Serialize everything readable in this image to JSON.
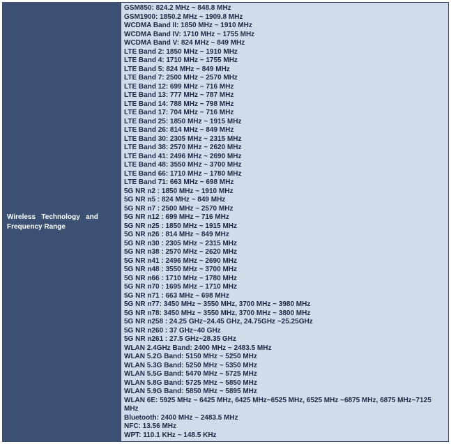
{
  "header": {
    "label_line1": "Wireless",
    "label_line2": "Technology",
    "label_line3": "and",
    "label_line4": "Frequency Range"
  },
  "frequencies": [
    "GSM850: 824.2 MHz ~ 848.8 MHz",
    "GSM1900: 1850.2 MHz ~ 1909.8 MHz",
    "WCDMA Band II: 1850 MHz ~ 1910 MHz",
    "WCDMA Band IV: 1710 MHz ~ 1755 MHz",
    "WCDMA Band V: 824 MHz ~ 849 MHz",
    "LTE Band 2: 1850 MHz ~ 1910 MHz",
    "LTE Band 4: 1710 MHz ~ 1755 MHz",
    "LTE Band 5: 824 MHz ~ 849 MHz",
    "LTE Band 7: 2500 MHz ~ 2570 MHz",
    "LTE Band 12: 699 MHz ~ 716 MHz",
    "LTE Band 13: 777 MHz ~ 787 MHz",
    "LTE Band 14: 788 MHz ~ 798 MHz",
    "LTE Band 17: 704 MHz ~ 716 MHz",
    "LTE Band 25: 1850 MHz ~ 1915 MHz",
    "LTE Band 26: 814 MHz ~ 849 MHz",
    "LTE Band 30: 2305 MHz ~ 2315 MHz",
    "LTE Band 38: 2570 MHz ~ 2620 MHz",
    "LTE Band 41: 2496 MHz ~ 2690 MHz",
    "LTE Band 48: 3550 MHz ~ 3700 MHz",
    "LTE Band 66: 1710 MHz ~ 1780 MHz",
    "LTE Band 71: 663 MHz ~ 698 MHz",
    "5G NR n2 : 1850 MHz ~ 1910 MHz",
    "5G NR n5 : 824 MHz ~ 849 MHz",
    "5G NR n7 : 2500 MHz ~ 2570 MHz",
    "5G NR n12 : 699 MHz ~ 716 MHz",
    "5G NR n25 : 1850 MHz ~ 1915 MHz",
    "5G NR n26 : 814 MHz ~ 849 MHz",
    "5G NR n30 : 2305 MHz ~ 2315 MHz",
    "5G NR n38 : 2570 MHz ~ 2620 MHz",
    "5G NR n41 : 2496 MHz ~ 2690 MHz",
    "5G NR n48 : 3550 MHz ~ 3700 MHz",
    "5G NR n66 : 1710 MHz ~ 1780 MHz",
    "5G NR n70 : 1695 MHz ~ 1710 MHz",
    "5G NR n71 : 663 MHz ~ 698 MHz",
    "5G NR n77: 3450 MHz ~ 3550 MHz, 3700 MHz ~ 3980 MHz",
    "5G NR n78: 3450 MHz ~ 3550 MHz, 3700 MHz ~ 3800 MHz",
    "5G NR n258 : 24.25 GHz~24.45 GHz, 24.75GHz ~25.25GHz",
    "5G NR n260 : 37 GHz~40 GHz",
    "5G NR n261 : 27.5 GHz~28.35 GHz",
    "WLAN 2.4GHz Band: 2400 MHz ~ 2483.5 MHz",
    "WLAN 5.2G Band: 5150 MHz ~ 5250 MHz",
    "WLAN 5.3G Band: 5250 MHz ~ 5350 MHz",
    "WLAN 5.5G Band: 5470 MHz ~ 5725 MHz",
    "WLAN 5.8G Band: 5725 MHz ~ 5850 MHz",
    "WLAN 5.9G Band: 5850 MHz ~ 5895 MHz",
    "WLAN 6E: 5925 MHz ~ 6425 MHz, 6425 MHz~6525 MHz, 6525 MHz ~6875 MHz, 6875 MHz~7125 MHz",
    "Bluetooth: 2400 MHz ~ 2483.5 MHz",
    "NFC: 13.56 MHz",
    "WPT: 110.1 KHz ~ 148.5 KHz"
  ]
}
